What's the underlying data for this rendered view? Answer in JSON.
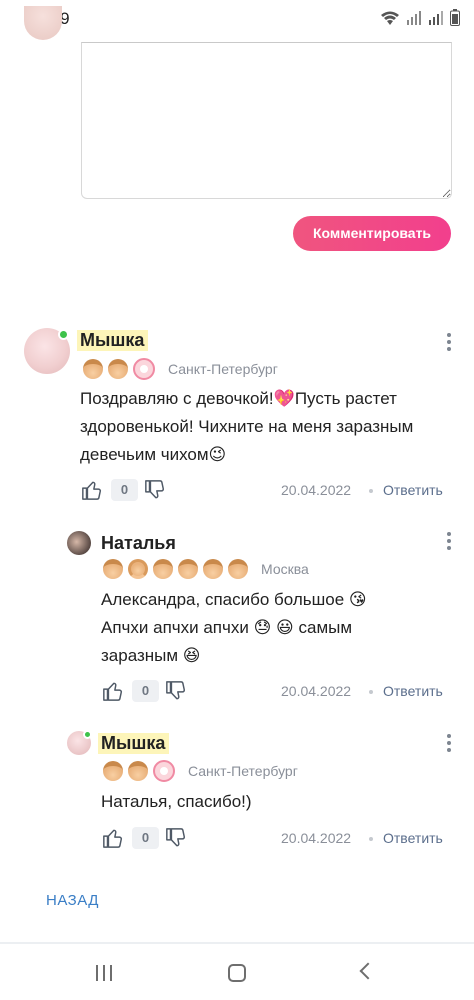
{
  "status_bar": {
    "time": "16:59"
  },
  "form": {
    "submit_label": "Комментировать"
  },
  "comments": [
    {
      "user": "Мышка",
      "city": "Санкт-Петербург",
      "lines": [
        "Поздравляю с девочкой!💖Пусть растет",
        "здоровенькой! Чихните на меня заразным",
        "девечьим чихом😉"
      ],
      "likes": "0",
      "date": "20.04.2022",
      "reply": "Ответить"
    },
    {
      "user": "Наталья",
      "city": "Москва",
      "lines": [
        "Александра, спасибо большое 😘",
        "Апчхи апчхи апчхи 😓 😃 самым",
        "заразным 😆"
      ],
      "likes": "0",
      "date": "20.04.2022",
      "reply": "Ответить"
    },
    {
      "user": "Мышка",
      "city": "Санкт-Петербург",
      "lines": [
        "Наталья, спасибо!)"
      ],
      "likes": "0",
      "date": "20.04.2022",
      "reply": "Ответить"
    }
  ],
  "footer": {
    "back_label": "НАЗАД"
  },
  "colors": {
    "accent": "#f0557f",
    "link": "#3a7ec6",
    "online": "#3ec24a",
    "highlight": "#fdf5b9"
  }
}
